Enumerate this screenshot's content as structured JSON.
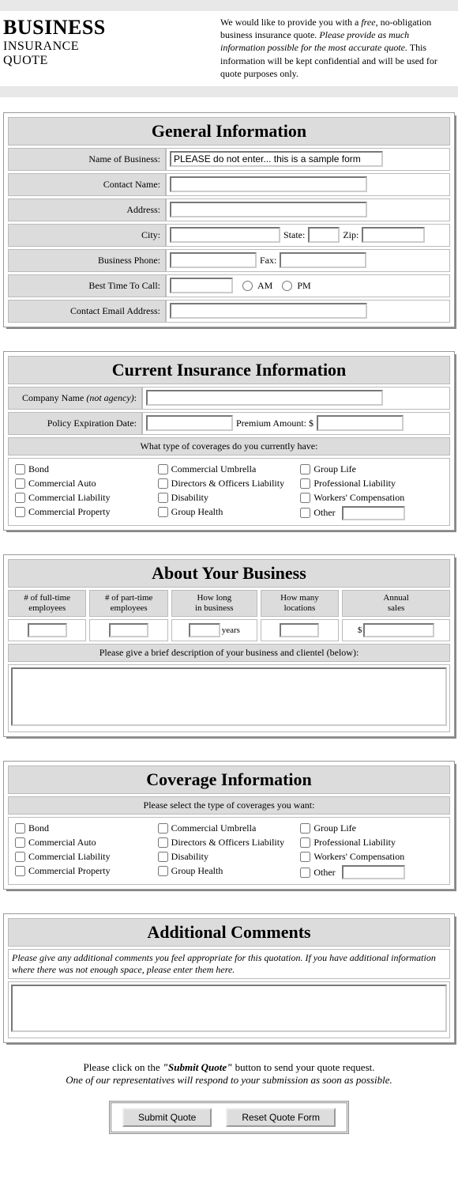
{
  "header": {
    "title_l1": "BUSINESS",
    "title_l2": "INSURANCE",
    "title_l3": "QUOTE",
    "copy_pre": "We would like to provide you with a ",
    "copy_free": "free",
    "copy_mid1": ", no-obligation business insurance quote. ",
    "copy_em": "Please provide as much information possible for the most accurate quote.",
    "copy_post": " This information will be kept confidential and will be used for quote purposes only."
  },
  "general": {
    "heading": "General Information",
    "labels": {
      "name_of_business": "Name of Business:",
      "contact_name": "Contact Name:",
      "address": "Address:",
      "city": "City:",
      "state": "State:",
      "zip": "Zip:",
      "business_phone": "Business Phone:",
      "fax": "Fax:",
      "best_time": "Best Time To Call:",
      "am": "AM",
      "pm": "PM",
      "email": "Contact Email Address:"
    },
    "values": {
      "name_of_business": "PLEASE do not enter... this is a sample form",
      "contact_name": "",
      "address": "",
      "city": "",
      "state": "",
      "zip": "",
      "business_phone": "",
      "fax": "",
      "best_time": "",
      "email": ""
    }
  },
  "current": {
    "heading": "Current Insurance Information",
    "labels": {
      "company_name": "Company Name ",
      "company_name_note": "(not agency)",
      "company_name_colon": ":",
      "policy_exp": "Policy Expiration Date:",
      "premium": "Premium Amount: $",
      "sub": "What type of coverages do you currently have:"
    },
    "values": {
      "company_name": "",
      "policy_exp": "",
      "premium": ""
    }
  },
  "coverages": [
    "Bond",
    "Commercial Auto",
    "Commercial Liability",
    "Commercial Property",
    "Commercial Umbrella",
    "Directors & Officers Liability",
    "Disability",
    "Group Health",
    "Group Life",
    "Professional Liability",
    "Workers' Compensation",
    "Other"
  ],
  "about": {
    "heading": "About Your Business",
    "headers": {
      "full": "# of full-time\nemployees",
      "part": "# of part-time\nemployees",
      "how_long": "How long\nin business",
      "locations": "How many\nlocations",
      "sales": "Annual\nsales"
    },
    "units": {
      "years": "years",
      "dollar": "$"
    },
    "values": {
      "full": "",
      "part": "",
      "how_long": "",
      "locations": "",
      "sales": ""
    },
    "sub": "Please give a brief description of your business and clientel (below):",
    "desc": ""
  },
  "coverage_info": {
    "heading": "Coverage Information",
    "sub": "Please select the type of coverages you want:"
  },
  "comments": {
    "heading": "Additional Comments",
    "instr": "Please give any additional comments you feel appropriate for this quotation. If you have additional information where there was not enough space, please enter them here.",
    "value": ""
  },
  "submit": {
    "line1_pre": "Please click on the ",
    "line1_q": "\"Submit Quote\"",
    "line1_post": " button to send your quote request.",
    "line2": "One of our representatives will respond to your submission as soon as possible.",
    "submit_btn": "Submit Quote",
    "reset_btn": "Reset Quote Form"
  }
}
